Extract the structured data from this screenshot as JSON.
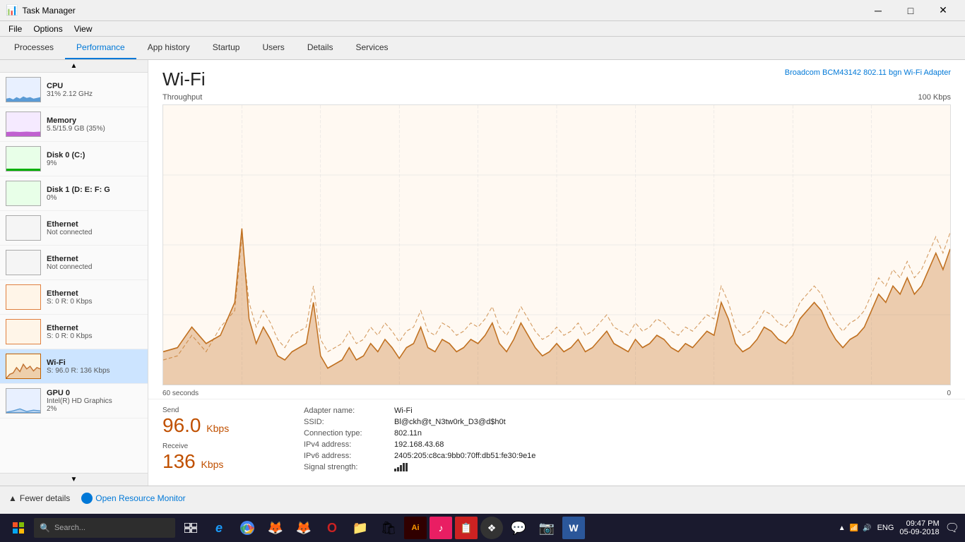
{
  "titleBar": {
    "title": "Task Manager",
    "minimizeLabel": "─",
    "maximizeLabel": "□",
    "closeLabel": "✕"
  },
  "menuBar": {
    "items": [
      "File",
      "Options",
      "View"
    ]
  },
  "tabs": [
    {
      "id": "processes",
      "label": "Processes"
    },
    {
      "id": "performance",
      "label": "Performance"
    },
    {
      "id": "app-history",
      "label": "App history"
    },
    {
      "id": "startup",
      "label": "Startup"
    },
    {
      "id": "users",
      "label": "Users"
    },
    {
      "id": "details",
      "label": "Details"
    },
    {
      "id": "services",
      "label": "Services"
    }
  ],
  "activeTab": "performance",
  "sidebar": {
    "items": [
      {
        "id": "cpu",
        "label": "CPU",
        "value": "31% 2.12 GHz",
        "graphType": "cpu"
      },
      {
        "id": "memory",
        "label": "Memory",
        "value": "5.5/15.9 GB (35%)",
        "graphType": "memory"
      },
      {
        "id": "disk0",
        "label": "Disk 0 (C:)",
        "value": "9%",
        "graphType": "disk0"
      },
      {
        "id": "disk1",
        "label": "Disk 1 (D: E: F: G",
        "value": "0%",
        "graphType": "disk1"
      },
      {
        "id": "ethernet1",
        "label": "Ethernet",
        "value": "Not connected",
        "graphType": "eth-nc"
      },
      {
        "id": "ethernet2",
        "label": "Ethernet",
        "value": "Not connected",
        "graphType": "eth-nc"
      },
      {
        "id": "ethernet3",
        "label": "Ethernet",
        "value": "S: 0 R: 0 Kbps",
        "graphType": "eth-wifi"
      },
      {
        "id": "ethernet4",
        "label": "Ethernet",
        "value": "S: 0 R: 0 Kbps",
        "graphType": "eth-wifi"
      },
      {
        "id": "wifi",
        "label": "Wi-Fi",
        "value": "S: 96.0 R: 136 Kbps",
        "graphType": "wifi",
        "active": true
      },
      {
        "id": "gpu",
        "label": "GPU 0",
        "value": "Intel(R) HD Graphics",
        "value2": "2%",
        "graphType": "gpu"
      }
    ]
  },
  "mainPanel": {
    "title": "Wi-Fi",
    "adapterName": "Broadcom BCM43142 802.11 bgn Wi-Fi Adapter",
    "chartLabel": "Throughput",
    "chartMax": "100 Kbps",
    "chartMin": "0",
    "chartDuration": "60 seconds",
    "send": {
      "label": "Send",
      "value": "96.0",
      "unit": "Kbps"
    },
    "receive": {
      "label": "Receive",
      "value": "136",
      "unit": "Kbps"
    },
    "stats": {
      "adapterNameLabel": "Adapter name:",
      "adapterNameValue": "Wi-Fi",
      "ssidLabel": "SSID:",
      "ssidValue": "Bl@ckh@t_N3tw0rk_D3@d$h0t",
      "connectionTypeLabel": "Connection type:",
      "connectionTypeValue": "802.11n",
      "ipv4Label": "IPv4 address:",
      "ipv4Value": "192.168.43.68",
      "ipv6Label": "IPv6 address:",
      "ipv6Value": "2405:205:c8ca:9bb0:70ff:db51:fe30:9e1e",
      "signalLabel": "Signal strength:"
    }
  },
  "bottomBar": {
    "fewerDetails": "Fewer details",
    "openResourceMonitor": "Open Resource Monitor"
  },
  "taskbar": {
    "time": "09:47 PM",
    "date": "05-09-2018",
    "language": "ENG",
    "apps": [
      {
        "id": "start",
        "icon": "⊞",
        "color": "#0078d7"
      },
      {
        "id": "edge",
        "icon": "e",
        "color": "#0078d7"
      },
      {
        "id": "chrome",
        "icon": "◉",
        "color": "#4285f4"
      },
      {
        "id": "firefox",
        "icon": "🦊",
        "color": "#ff6600"
      },
      {
        "id": "firefox-beta",
        "icon": "🦊",
        "color": "#ff9900"
      },
      {
        "id": "opera",
        "icon": "O",
        "color": "#cc0000"
      },
      {
        "id": "explorer",
        "icon": "📁",
        "color": "#ffb900"
      },
      {
        "id": "store",
        "icon": "🛍",
        "color": "#0078d7"
      },
      {
        "id": "illustrator",
        "icon": "Ai",
        "color": "#ff9a00"
      },
      {
        "id": "music",
        "icon": "♫",
        "color": "#e91e63"
      },
      {
        "id": "task",
        "icon": "📋",
        "color": "#cc2200"
      },
      {
        "id": "app1",
        "icon": "❖",
        "color": "#555"
      },
      {
        "id": "whatsapp",
        "icon": "💬",
        "color": "#25d366"
      },
      {
        "id": "cam",
        "icon": "📷",
        "color": "#888"
      },
      {
        "id": "word",
        "icon": "W",
        "color": "#2b579a"
      }
    ]
  }
}
